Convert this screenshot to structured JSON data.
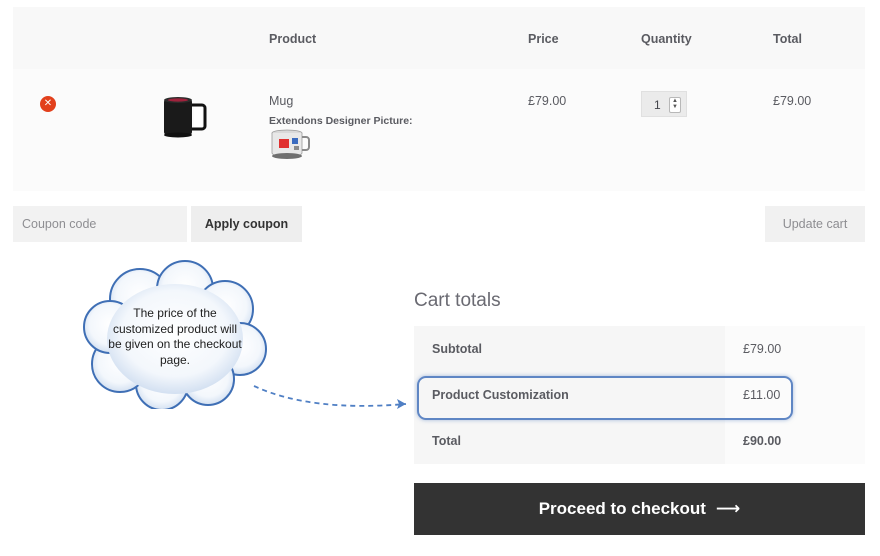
{
  "cart_table": {
    "headers": {
      "product": "Product",
      "price": "Price",
      "quantity": "Quantity",
      "total": "Total"
    },
    "items": [
      {
        "name": "Mug",
        "designer_label": "Extendons Designer Picture:",
        "price": "£79.00",
        "quantity": "1",
        "total": "£79.00"
      }
    ]
  },
  "coupon": {
    "placeholder": "Coupon code",
    "apply_label": "Apply coupon"
  },
  "update_cart_label": "Update cart",
  "cart_totals": {
    "title": "Cart totals",
    "rows": [
      {
        "label": "Subtotal",
        "value": "£79.00"
      },
      {
        "label": "Product Customization",
        "value": "£11.00"
      },
      {
        "label": "Total",
        "value": "£90.00"
      }
    ]
  },
  "checkout": {
    "label": "Proceed to checkout",
    "arrow": "⟶"
  },
  "callout": {
    "text": "The price of the customized product will be given on the checkout page."
  },
  "icons": {
    "remove": "remove-icon",
    "arrow": "arrow-right-icon"
  },
  "colors": {
    "remove_red": "#e2401c",
    "checkout_bg": "#333333",
    "highlight_blue": "#5f86c4",
    "cloud_border": "#3f6fb5"
  }
}
